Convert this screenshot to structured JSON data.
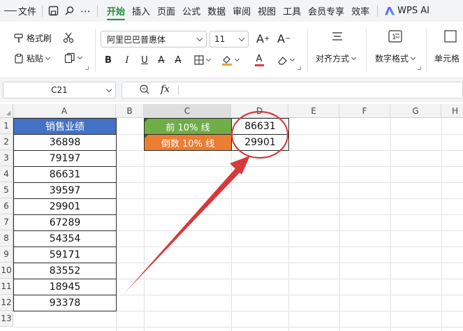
{
  "menubar": {
    "file_label": "文件",
    "tabs": [
      "开始",
      "插入",
      "页面",
      "公式",
      "数据",
      "审阅",
      "视图",
      "工具",
      "会员专享",
      "效率"
    ],
    "active_tab": "开始",
    "ai_label": "WPS AI"
  },
  "ribbon": {
    "format_painter": "格式刷",
    "paste": "粘贴",
    "font_name": "阿里巴巴普惠体",
    "font_size": "11",
    "align_label": "对齐方式",
    "number_format_label": "数字格式",
    "cell_label": "单元格",
    "accent_color": "#1f8f3a"
  },
  "formula_bar": {
    "name_box": "C21",
    "fx_label": "fx",
    "formula": ""
  },
  "sheet": {
    "columns": [
      "A",
      "B",
      "C",
      "D",
      "E",
      "F",
      "G",
      "H"
    ],
    "rows": [
      "1",
      "2",
      "3",
      "4",
      "5",
      "6",
      "7",
      "8",
      "9",
      "10",
      "11",
      "12",
      "13"
    ],
    "col_a_header": "销售业绩",
    "col_a_values": [
      "36898",
      "79197",
      "86631",
      "39597",
      "29901",
      "67289",
      "54354",
      "59171",
      "83552",
      "18945",
      "93378"
    ],
    "label_top": "前 10% 线",
    "label_bottom": "倒数 10% 线",
    "value_top": "86631",
    "value_bottom": "29901",
    "colors": {
      "header_blue": "#4472c4",
      "green": "#70ad47",
      "orange": "#ed7d31",
      "annotation_red": "#d9383a"
    }
  }
}
